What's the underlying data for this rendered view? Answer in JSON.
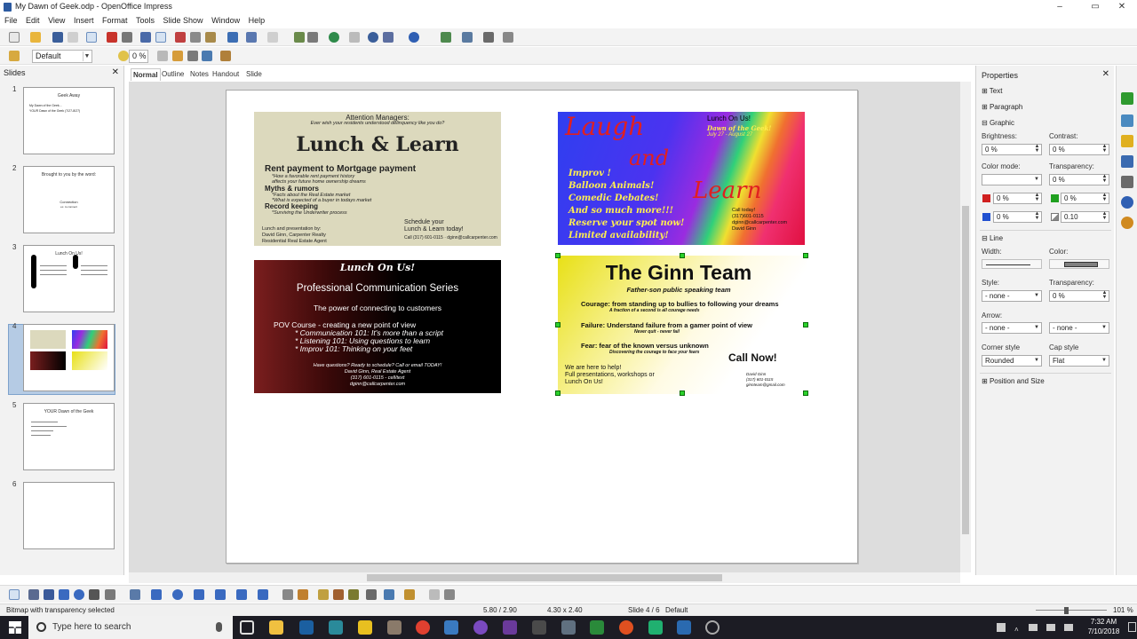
{
  "window": {
    "title": "My Dawn of Geek.odp - OpenOffice Impress",
    "minimize": "–",
    "maximize": "▭",
    "close": "✕"
  },
  "menu": [
    "File",
    "Edit",
    "View",
    "Insert",
    "Format",
    "Tools",
    "Slide Show",
    "Window",
    "Help"
  ],
  "toolbar2": {
    "style_combo": "Default",
    "rotation_value": "0 %"
  },
  "slides_panel": {
    "header": "Slides",
    "close": "✕",
    "thumbnails": [
      {
        "num": "1",
        "title": "Geek Away",
        "lines": [
          "My Dawn of the Geek...",
          "YOUR Dawn of the Geek (7/27-8/27)"
        ]
      },
      {
        "num": "2",
        "title": "Brought to you by the word:",
        "lines": [
          "Connection",
          "ex. to connect"
        ]
      },
      {
        "num": "3",
        "title": "Lunch On Us!",
        "lines": []
      },
      {
        "num": "4",
        "title": "",
        "lines": []
      },
      {
        "num": "5",
        "title": "YOUR Dawn of the Geek",
        "lines": []
      },
      {
        "num": "6",
        "title": "",
        "lines": []
      }
    ]
  },
  "view_tabs": [
    "Normal",
    "Outline",
    "Notes",
    "Handout",
    "Slide Sorter"
  ],
  "slide": {
    "card1": {
      "line1": "Attention Managers:",
      "line2": "Ever wish your residents understood delinquency like you do?",
      "headline": "Lunch & Learn",
      "sub1": "Rent payment to Mortgage payment",
      "sub1a": "*How a favorable rent payment history",
      "sub1b": "affects your future home ownership dreams",
      "sub2": "Myths & rumors",
      "sub2a": "*Facts about the Real Estate market",
      "sub2b": "*What is expected of a buyer in todays market",
      "sub3": "Record keeping",
      "sub3a": "*Surviving the Underwriter process",
      "left_footer1": "Lunch and presentation by:",
      "left_footer2": "David Ginn, Carpenter Realty",
      "left_footer3": "Residential Real Estate Agent",
      "right_footer1": "Schedule your",
      "right_footer2": "Lunch & Learn today!",
      "right_footer3": "Call (317) 601-0115 · dginn@callcarpenter.com"
    },
    "card2": {
      "laugh": "Laugh",
      "and": "and",
      "learn": "Learn",
      "lunch": "Lunch On Us!",
      "dawn": "Dawn of the Geek!",
      "dates": "July 27 - August 27",
      "bullets": [
        "Improv !",
        "Balloon Animals!",
        "Comedic Debates!",
        "And so much more!!!",
        "Reserve your spot now!",
        "Limited availability!"
      ],
      "contact1": "Call today!",
      "contact2": "(317)601-0115",
      "contact3": "dginn@callcarpenter.com",
      "contact4": "David Ginn"
    },
    "card3": {
      "title": "Lunch On Us!",
      "series": "Professional Communication Series",
      "tagline": "The power of connecting to customers",
      "pov": "POV Course - creating a new point of view",
      "b1": "* Communication 101: It's more than a script",
      "b2": "* Listening 101: Using questions to learn",
      "b3": "* Improv 101: Thinking on your feet",
      "q": "Have questions? Ready to schedule? Call or email TODAY!",
      "n1": "David Ginn, Real Estate Agent",
      "n2": "(317) 601-0115 - cell/text",
      "n3": "dginn@callcarpenter.com"
    },
    "card4": {
      "title": "The Ginn Team",
      "subtitle": "Father-son public speaking team",
      "courage": "Courage: from standing up to bullies to following your dreams",
      "courage_sub": "A fraction of a second is all courage needs",
      "failure": "Failure: Understand failure from a gamer point of view",
      "failure_sub": "Never quit - never fail",
      "fear": "Fear: fear of the known versus unknown",
      "fear_sub": "Discovering the courage to face your fears",
      "here1": "We are here to help!",
      "here2": "Full presentations, workshops or",
      "here3": "Lunch On Us!",
      "callnow": "Call Now!",
      "c1": "David Ginn",
      "c2": "(317) 601-0115",
      "c3": "ginnteam@gmail.com"
    }
  },
  "properties": {
    "header": "Properties",
    "close": "✕",
    "sections": {
      "text": "Text",
      "paragraph": "Paragraph",
      "graphic": "Graphic",
      "line": "Line",
      "position": "Position and Size"
    },
    "graphic": {
      "brightness_label": "Brightness:",
      "brightness": "0 %",
      "contrast_label": "Contrast:",
      "contrast": "0 %",
      "colormode_label": "Color mode:",
      "colormode": "",
      "transparency_label": "Transparency:",
      "transparency": "0 %",
      "red": "0 %",
      "green": "0 %",
      "blue": "0 %",
      "gamma": "0.10"
    },
    "line": {
      "width_label": "Width:",
      "color_label": "Color:",
      "style_label": "Style:",
      "style": "- none -",
      "transparency_label": "Transparency:",
      "transparency": "0 %",
      "arrow_label": "Arrow:",
      "arrow_start": "- none -",
      "arrow_end": "- none -",
      "corner_label": "Corner style",
      "corner": "Rounded",
      "cap_label": "Cap style",
      "cap": "Flat"
    }
  },
  "statusbar": {
    "message": "Bitmap with transparency selected",
    "position": "5.80 / 2.90",
    "size": "4.30 x 2.40",
    "slide": "Slide 4 / 6",
    "master": "Default",
    "zoom": "101 %"
  },
  "taskbar": {
    "search_placeholder": "Type here to search",
    "time": "7:32 AM",
    "date": "7/10/2018"
  },
  "colors": {
    "workspace": "#dddddd",
    "selected_thumb": "#b5cbe4",
    "handle": "#2bd12b",
    "taskbar": "#1c1c24"
  }
}
